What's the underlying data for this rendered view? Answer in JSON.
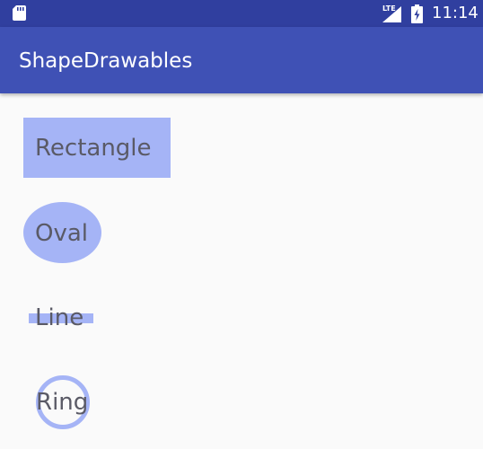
{
  "status_bar": {
    "time": "11:14",
    "network_label": "LTE",
    "icons": [
      "sd-card-icon",
      "signal-icon",
      "battery-charging-icon"
    ]
  },
  "toolbar": {
    "title": "ShapeDrawables"
  },
  "shapes": {
    "rectangle": "Rectangle",
    "oval": "Oval",
    "line": "Line",
    "ring": "Ring"
  },
  "colors": {
    "status_bar": "#303f9f",
    "toolbar": "#3f51b5",
    "shape_fill": "#a5b4f6",
    "background": "#fafafa",
    "label_text": "#5a5a66"
  }
}
